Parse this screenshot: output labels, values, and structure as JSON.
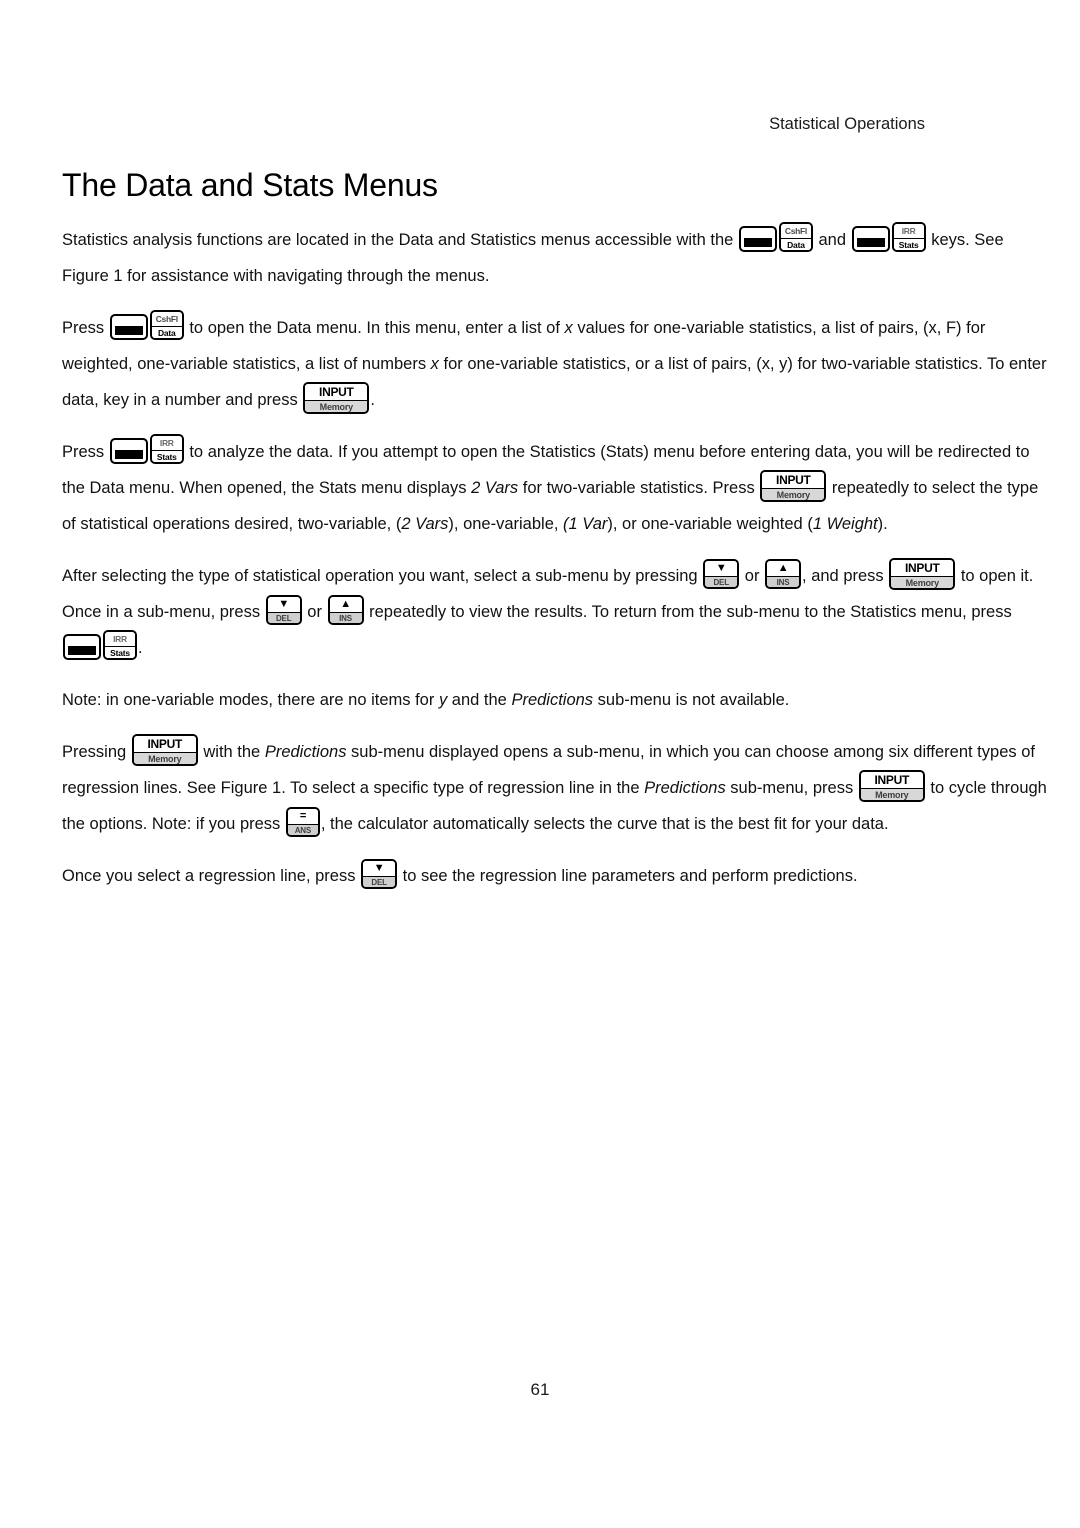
{
  "page": {
    "running_head": "Statistical Operations",
    "title": "The Data and Stats Menus",
    "page_number": "61"
  },
  "keys": {
    "second": {
      "name": "2nd",
      "top_label": "",
      "bottom_label": ""
    },
    "cshfl_data": {
      "top_label": "CshFl",
      "bottom_label": "Data"
    },
    "irr_stats": {
      "top_label": "IRR",
      "bottom_label": "Stats"
    },
    "input_memory": {
      "top_label": "INPUT",
      "bottom_label": "Memory"
    },
    "down_del": {
      "top_label": "▼",
      "bottom_label": "DEL"
    },
    "up_ins": {
      "top_label": "▲",
      "bottom_label": "INS"
    },
    "equals_ans": {
      "top_label": "=",
      "bottom_label": "ANS"
    }
  },
  "paragraphs": {
    "p1": {
      "s1": "Statistics analysis functions are located in the Data and Statistics menus accessible with the ",
      "s2": " and ",
      "s3": " keys. See Figure 1 for assistance with navigating through the menus."
    },
    "p2": {
      "s1": "Press ",
      "s2": " to open the Data menu. In this menu, enter a list of ",
      "em1": "x",
      "s3": " values for one-variable statistics, a list of pairs, (x, F) for weighted, one-variable statistics, a list of numbers ",
      "em2": "x",
      "s4": " for one-variable statistics, or a list of pairs, (x, y) for two-variable statistics. To enter data, key in a number and press ",
      "s5": "."
    },
    "p3": {
      "s1": "Press ",
      "s2": " to analyze the data. If you attempt to open the Statistics (Stats) menu before entering data, you will be redirected to the Data menu. When opened, the Stats menu displays ",
      "em1": "2 Vars",
      "s3": " for two-variable statistics. Press ",
      "s4": " repeatedly to select the type of statistical operations desired, two-variable, (",
      "em2": "2 Vars",
      "s5": "), one-variable, ",
      "em3": "(1 Var",
      "s6": "), or one-variable weighted (",
      "em4": "1 Weight",
      "s7": ")."
    },
    "p4": {
      "s1": "After selecting the type of statistical operation you want, select a sub-menu by pressing ",
      "s2": " or ",
      "s3": ", and press ",
      "s4": " to open it. Once in a sub-menu, press ",
      "s5": " or ",
      "s6": " repeatedly to view the results. To return from the sub-menu to the Statistics menu, press ",
      "s7": "."
    },
    "p5": {
      "s1": "Note: in one-variable modes, there are no items for ",
      "em1": "y",
      "s2": " and the ",
      "em2": "Predictions",
      "s3": " sub-menu is not available."
    },
    "p6": {
      "s1": "Pressing ",
      "s2": " with the ",
      "em1": "Predictions",
      "s3": " sub-menu displayed opens a sub-menu, in which you can choose among six different types of regression lines. See Figure 1. To select a specific type of regression line in the ",
      "em2": "Predictions",
      "s4": " sub-menu, press ",
      "s5": " to cycle through the options. Note: if you press ",
      "s6": ", the calculator automatically selects the curve that is the best fit for your data."
    },
    "p7": {
      "s1": "Once you select a regression line, press ",
      "s2": " to see the regression line parameters and perform predictions."
    }
  }
}
